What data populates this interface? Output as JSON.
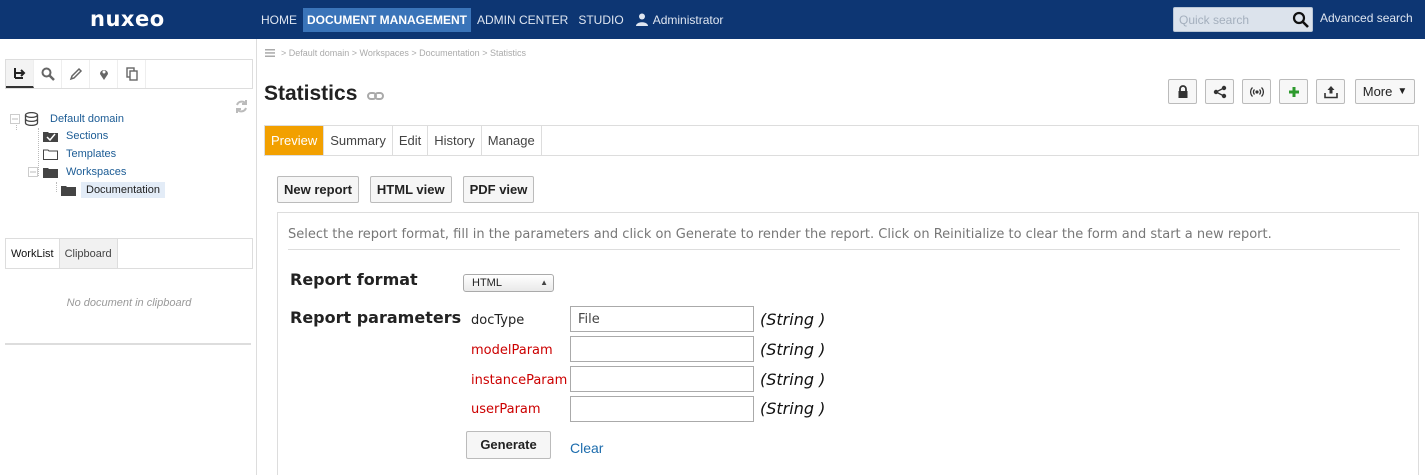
{
  "header": {
    "logo": "nuxeo",
    "nav": [
      "HOME",
      "DOCUMENT MANAGEMENT",
      "ADMIN CENTER",
      "STUDIO"
    ],
    "active_nav": "DOCUMENT MANAGEMENT",
    "user": "Administrator",
    "search_placeholder": "Quick search",
    "advanced_search": "Advanced search"
  },
  "sidebar": {
    "tree": {
      "root": "Default domain",
      "sections": "Sections",
      "templates": "Templates",
      "workspaces": "Workspaces",
      "documentation": "Documentation"
    },
    "worklist_tabs": [
      "WorkList",
      "Clipboard"
    ],
    "empty_message": "No document in clipboard"
  },
  "breadcrumb": "> Default domain > Workspaces > Documentation > Statistics",
  "page": {
    "title": "Statistics",
    "more_label": "More",
    "tabs": [
      "Preview",
      "Summary",
      "Edit",
      "History",
      "Manage"
    ],
    "active_tab": "Preview"
  },
  "report": {
    "view_buttons": [
      "New report",
      "HTML view",
      "PDF view"
    ],
    "description": "Select the report format, fill in the parameters and click on Generate to render the report. Click on Reinitialize to clear the form and start a new report.",
    "format_label": "Report format",
    "format_value": "HTML",
    "params_label": "Report parameters",
    "params": [
      {
        "name": "docType",
        "value": "File",
        "type": "(String )",
        "required": false
      },
      {
        "name": "modelParam",
        "value": "",
        "type": "(String )",
        "required": true
      },
      {
        "name": "instanceParam",
        "value": "",
        "type": "(String )",
        "required": true
      },
      {
        "name": "userParam",
        "value": "",
        "type": "(String )",
        "required": true
      }
    ],
    "generate_label": "Generate",
    "clear_label": "Clear"
  },
  "colors": {
    "header_bg": "#0d3673",
    "nav_active_bg": "#3a74b9",
    "tab_active_bg": "#f2a000",
    "required": "#cc0000",
    "link": "#1c6cad"
  }
}
